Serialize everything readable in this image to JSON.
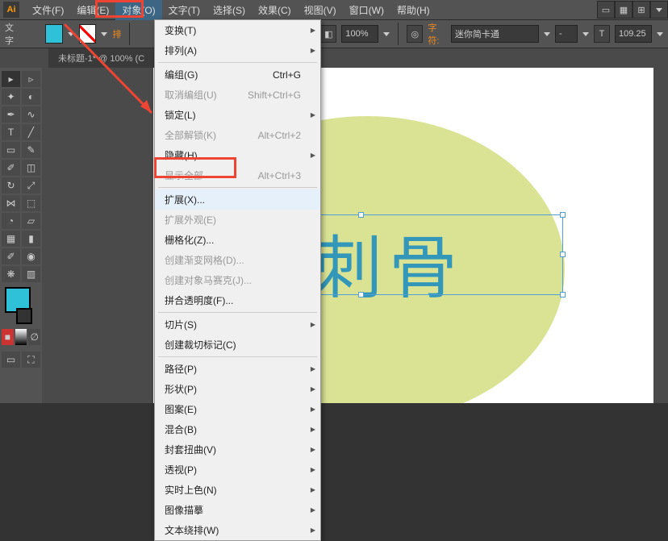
{
  "app": {
    "logo": "Ai"
  },
  "menu": {
    "file": "文件(F)",
    "edit": "编辑(E)",
    "object": "对象(O)",
    "type": "文字(T)",
    "select": "选择(S)",
    "effect": "效果(C)",
    "view": "视图(V)",
    "window": "窗口(W)",
    "help": "帮助(H)"
  },
  "topbar": {
    "label_text": "文字",
    "orange_swatch": "#f28c1b",
    "zoom": "100%",
    "char_label": "字符:",
    "font": "迷你简卡通",
    "opacity": "109.25"
  },
  "tab": {
    "title": "未标题-1* @ 100% (C"
  },
  "dropdown": {
    "transform": "变换(T)",
    "arrange": "排列(A)",
    "group": "编组(G)",
    "group_sc": "Ctrl+G",
    "ungroup": "取消编组(U)",
    "ungroup_sc": "Shift+Ctrl+G",
    "lock": "锁定(L)",
    "unlock_all": "全部解锁(K)",
    "unlock_sc": "Alt+Ctrl+2",
    "hide": "隐藏(H)",
    "show_all": "显示全部",
    "show_sc": "Alt+Ctrl+3",
    "expand": "扩展(X)...",
    "expand_appearance": "扩展外观(E)",
    "rasterize": "栅格化(Z)...",
    "gradient_mesh": "创建渐变网格(D)...",
    "mosaic": "创建对象马赛克(J)...",
    "flatten": "拼合透明度(F)...",
    "slice": "切片(S)",
    "crop_marks": "创建裁切标记(C)",
    "path": "路径(P)",
    "shape": "形状(P)",
    "pattern": "图案(E)",
    "blend": "混合(B)",
    "envelope": "封套扭曲(V)",
    "perspective": "透视(P)",
    "live_paint": "实时上色(N)",
    "image_trace": "图像描摹",
    "text_wrap": "文本绕排(W)"
  },
  "canvas": {
    "text_content": "冰霜刺骨",
    "ellipse_color": "#dae394",
    "text_color": "#3397ba"
  }
}
